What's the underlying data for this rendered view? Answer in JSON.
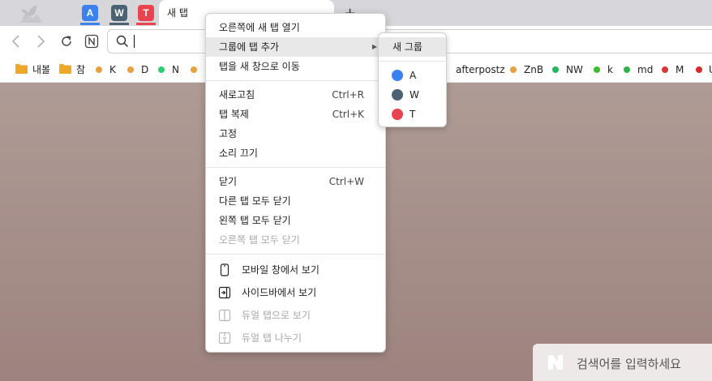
{
  "tabs": {
    "pinned": [
      {
        "letter": "A",
        "color": "#3b82f0"
      },
      {
        "letter": "W",
        "color": "#4a6272"
      },
      {
        "letter": "T",
        "color": "#e8434f"
      }
    ],
    "active_title": "새 탭",
    "new_tab_symbol": "+"
  },
  "toolbar": {
    "back_icon": "chevron-left-icon",
    "forward_icon": "chevron-right-icon",
    "reload_icon": "reload-icon",
    "home_icon": "naver-n-icon",
    "search_icon": "search-icon"
  },
  "bookmarks": [
    {
      "label": "내볼",
      "kind": "folder",
      "color": "#f0a828"
    },
    {
      "label": "참",
      "kind": "folder",
      "color": "#f0a828"
    },
    {
      "label": "K",
      "kind": "dot",
      "color": "#e8a040"
    },
    {
      "label": "D",
      "kind": "dot",
      "color": "#e8a040"
    },
    {
      "label": "N",
      "kind": "dot",
      "color": "#2ecf70"
    },
    {
      "label": "afterpostz",
      "kind": "dot",
      "color": "#e8a040"
    },
    {
      "label": "ZnB",
      "kind": "dot",
      "color": "#e8a040"
    },
    {
      "label": "NW",
      "kind": "dot",
      "color": "#1fb85a"
    },
    {
      "label": "k",
      "kind": "dot",
      "color": "#3dbd2e"
    },
    {
      "label": "md",
      "kind": "dot",
      "color": "#2fb24a"
    },
    {
      "label": "M",
      "kind": "dot",
      "color": "#d93636"
    },
    {
      "label": "U",
      "kind": "dot",
      "color": "#d62a2a"
    }
  ],
  "context_menu": {
    "open_new_tab_right": "오른쪽에 새 탭 열기",
    "add_tab_to_group": "그룹에 탭 추가",
    "move_tab_to_new_window": "탭을 새 창으로 이동",
    "reload": "새로고침",
    "reload_shortcut": "Ctrl+R",
    "duplicate": "탭 복제",
    "duplicate_shortcut": "Ctrl+K",
    "pin": "고정",
    "mute": "소리 끄기",
    "close": "닫기",
    "close_shortcut": "Ctrl+W",
    "close_other_tabs": "다른 탭 모두 닫기",
    "close_tabs_left": "왼쪽 탭 모두 닫기",
    "close_tabs_right": "오른쪽 탭 모두 닫기",
    "view_in_mobile_window": "모바일 창에서 보기",
    "view_in_sidebar": "사이드바에서 보기",
    "view_as_dual_tab": "듀얼 탭으로 보기",
    "split_dual_tab": "듀얼 탭 나누기"
  },
  "group_submenu": {
    "new_group": "새 그룹",
    "groups": [
      {
        "label": "A",
        "color": "#3b82f0"
      },
      {
        "label": "W",
        "color": "#4a6272"
      },
      {
        "label": "T",
        "color": "#e8434f"
      }
    ]
  },
  "search_widget": {
    "placeholder": "검색어를 입력하세요"
  }
}
